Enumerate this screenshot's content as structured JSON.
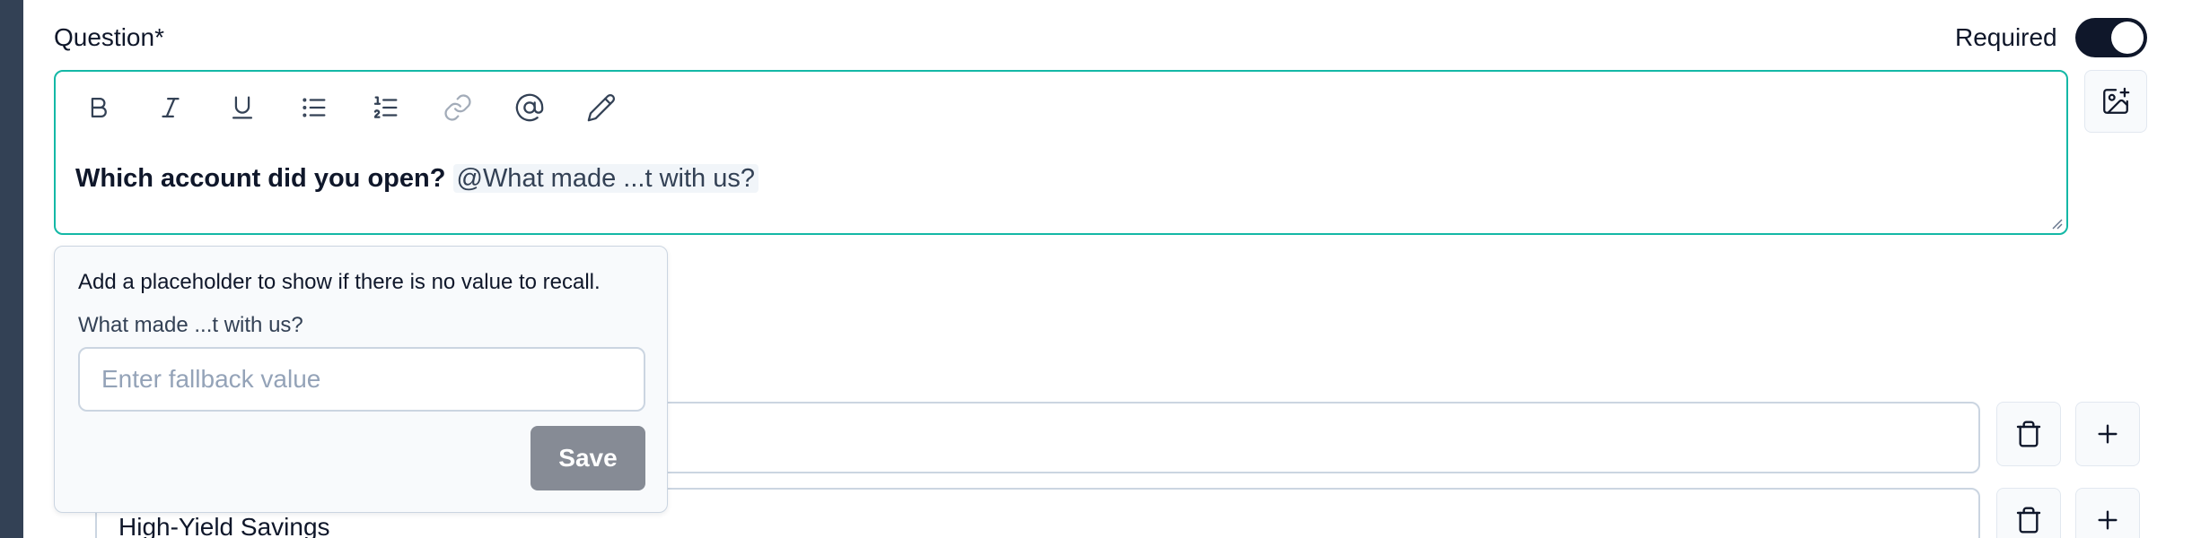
{
  "question": {
    "label": "Question*",
    "required_label": "Required",
    "required_on": true,
    "text_bold": "Which account did you open?",
    "mention": "@What made ...t with us?"
  },
  "toolbar": {
    "tools": [
      "bold-icon",
      "italic-icon",
      "underline-icon",
      "bullet-list-icon",
      "numbered-list-icon",
      "link-icon",
      "at-sign-icon",
      "pencil-icon"
    ]
  },
  "colors": {
    "accent": "#14b8a6",
    "toggle": "#0f172a",
    "save_button": "#868b95",
    "sidebar": "#334155"
  },
  "fallback_popover": {
    "description": "Add a placeholder to show if there is no value to recall.",
    "recall_label": "What made ...t with us?",
    "input_value": "",
    "input_placeholder": "Enter fallback value",
    "save_label": "Save"
  },
  "options": [
    {
      "value": ""
    },
    {
      "value": "High-Yield Savings"
    }
  ]
}
